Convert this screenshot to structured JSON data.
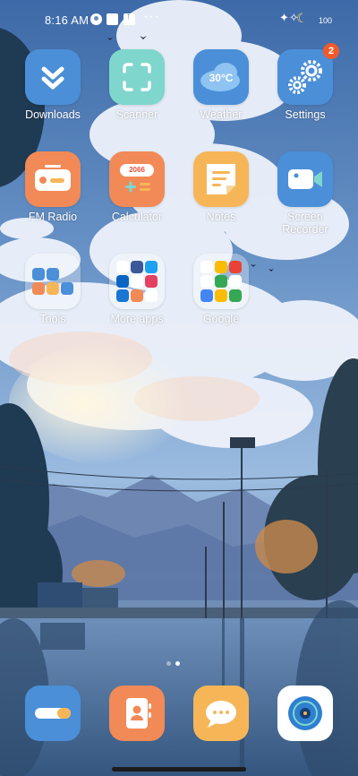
{
  "status_bar": {
    "time": "8:16 AM",
    "more": "···",
    "battery": "100"
  },
  "apps": [
    {
      "label": "Downloads",
      "icon": "downloads-icon"
    },
    {
      "label": "Scanner",
      "icon": "scanner-icon"
    },
    {
      "label": "Weather",
      "icon": "weather-icon",
      "value": "30°C"
    },
    {
      "label": "Settings",
      "icon": "settings-icon",
      "badge": "2"
    },
    {
      "label": "FM Radio",
      "icon": "fm-radio-icon"
    },
    {
      "label": "Calculator",
      "icon": "calculator-icon",
      "value": "2066"
    },
    {
      "label": "Notes",
      "icon": "notes-icon"
    },
    {
      "label": "Screen Recorder",
      "icon": "screen-recorder-icon"
    }
  ],
  "folders": [
    {
      "label": "Tools"
    },
    {
      "label": "More apps"
    },
    {
      "label": "Google"
    }
  ],
  "dock": [
    {
      "name": "phone-app",
      "icon": "toggle-icon"
    },
    {
      "name": "contacts-app",
      "icon": "contacts-icon"
    },
    {
      "name": "messaging-app",
      "icon": "message-icon"
    },
    {
      "name": "camera-app",
      "icon": "camera-icon"
    }
  ],
  "colors": {
    "blue_icon": "#4a8fd8",
    "teal_icon": "#7fd6cd",
    "orange_icon": "#f18a57",
    "yellow_icon": "#f6b658",
    "badge": "#f05a2b"
  }
}
